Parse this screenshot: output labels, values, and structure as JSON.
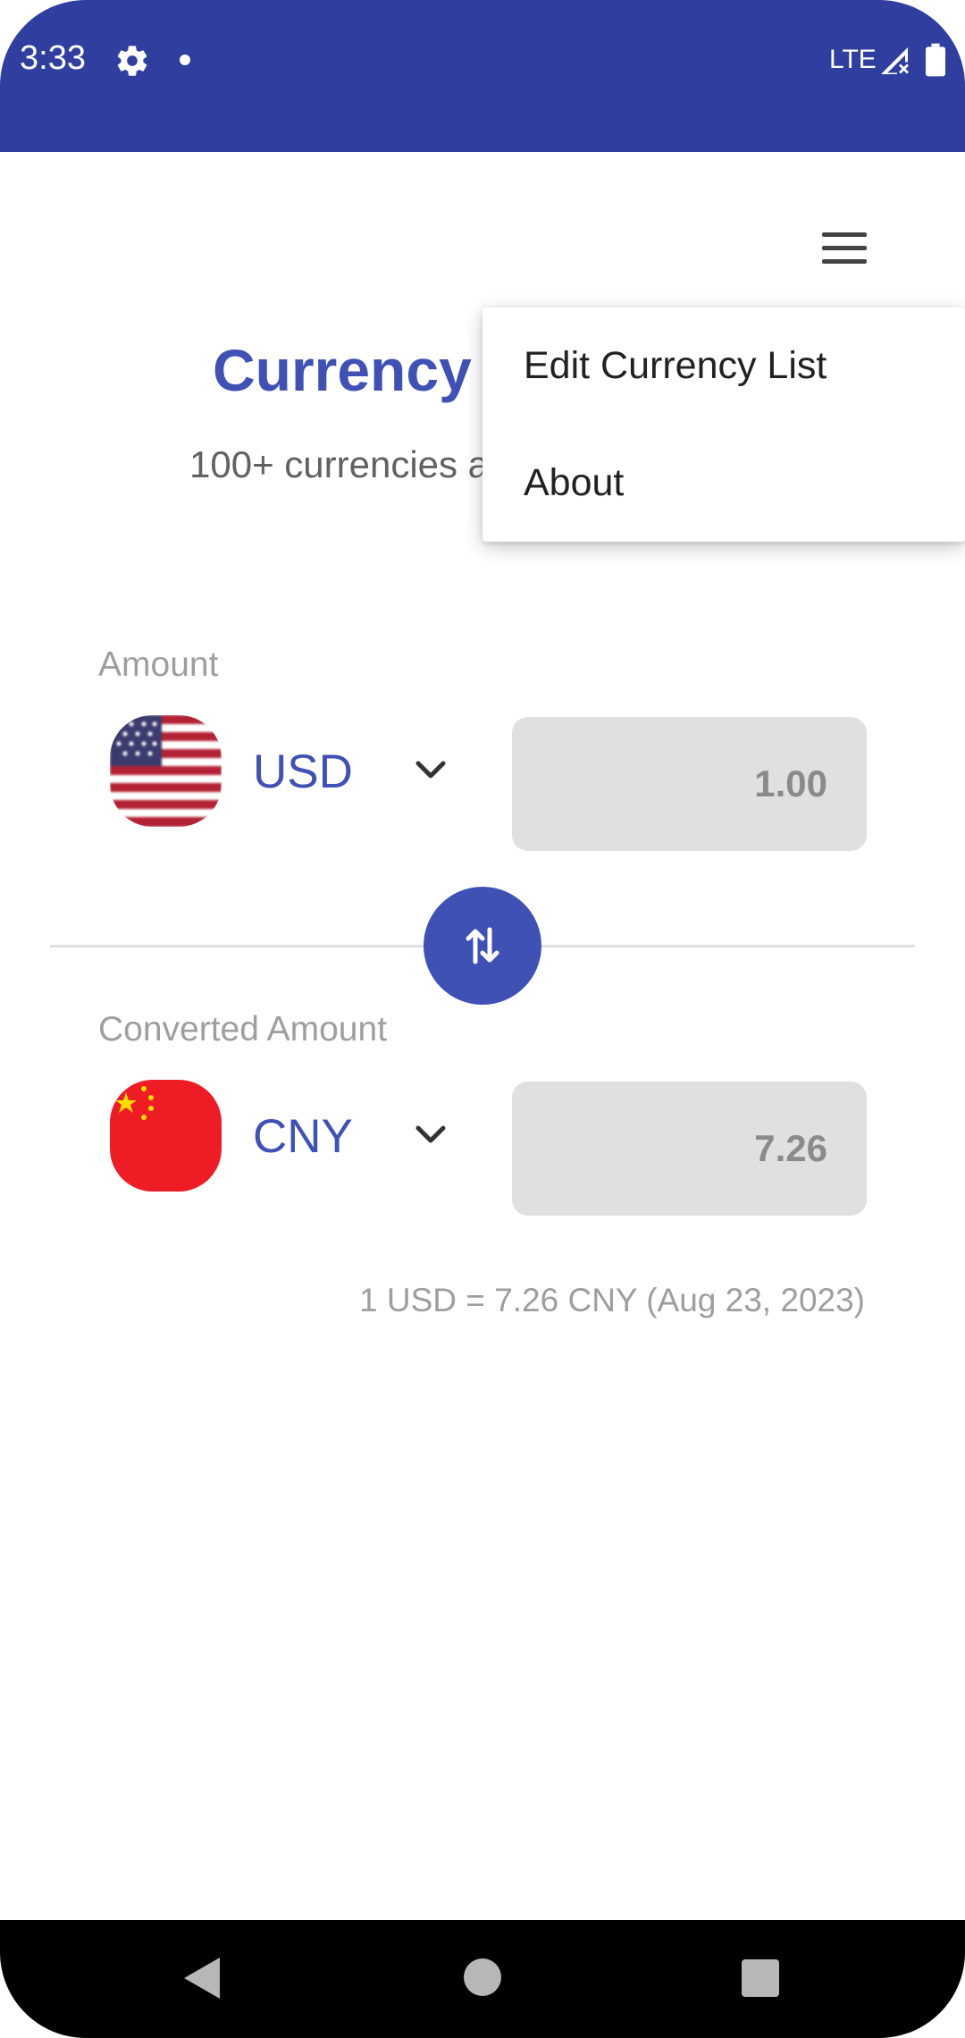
{
  "status_bar": {
    "time": "3:33",
    "network": "LTE",
    "background_color": "#303f9f",
    "icons": [
      "gear-icon",
      "notification-dot-icon",
      "signal-icon",
      "battery-icon"
    ]
  },
  "header": {
    "menu_icon": "hamburger-menu-icon",
    "title": "Currency C",
    "subtitle": "100+ currencies a"
  },
  "overflow_menu": {
    "items": [
      {
        "label": "Edit Currency List"
      },
      {
        "label": "About"
      }
    ]
  },
  "converter": {
    "from": {
      "label": "Amount",
      "code": "USD",
      "flag": "us-flag-icon",
      "value": "1.00"
    },
    "swap_icon": "swap-arrows-icon",
    "to": {
      "label": "Converted Amount",
      "code": "CNY",
      "flag": "cn-flag-icon",
      "value": "7.26"
    },
    "rate_text": "1 USD = 7.26 CNY (Aug 23, 2023)"
  },
  "colors": {
    "accent": "#3f51b5",
    "field_bg": "#e0e0e0",
    "label": "#9e9e9e"
  },
  "nav_bar": {
    "icons": [
      "back-icon",
      "home-icon",
      "recents-icon"
    ]
  }
}
